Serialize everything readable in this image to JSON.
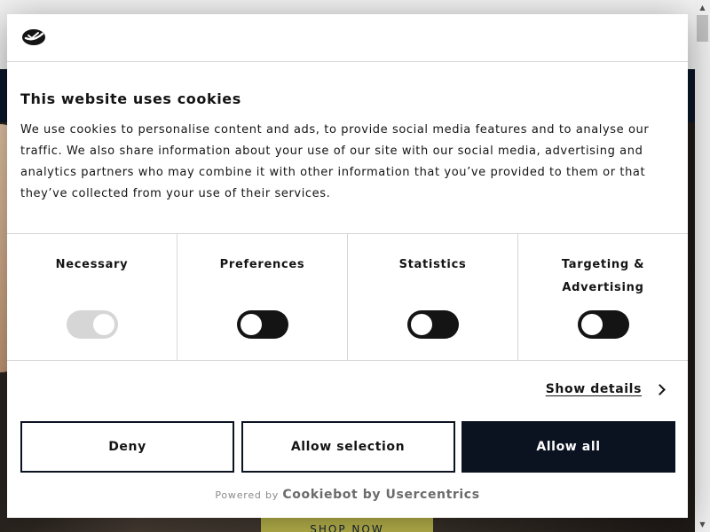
{
  "background": {
    "cta_label": "SHOP NOW"
  },
  "dialog": {
    "title": "This website uses cookies",
    "description": "We use cookies to personalise content and ads, to provide social media features and to analyse our traffic. We also share information about your use of our site with our social media, advertising and analytics partners who may combine it with other information that you’ve provided to them or that they’ve collected from your use of their services.",
    "toggles": [
      {
        "label": "Necessary",
        "checked": true,
        "disabled": true
      },
      {
        "label": "Preferences",
        "checked": false,
        "disabled": false
      },
      {
        "label": "Statistics",
        "checked": false,
        "disabled": false
      },
      {
        "label": "Targeting & Advertising",
        "checked": false,
        "disabled": false
      }
    ],
    "show_details_label": "Show details",
    "buttons": {
      "deny": "Deny",
      "allow_selection": "Allow selection",
      "allow_all": "Allow all"
    },
    "footer": {
      "powered_by": "Powered by",
      "brand": "Cookiebot by Usercentrics"
    }
  },
  "colors": {
    "primary": "#0b1220",
    "toggle_off": "#141414",
    "toggle_disabled": "#d6d6d6",
    "nav_bg": "#0a1628",
    "cta_bg": "#c1bd4f"
  },
  "icons": {
    "logo": "cookiebot-logo-icon",
    "chevron": "chevron-right-icon"
  }
}
